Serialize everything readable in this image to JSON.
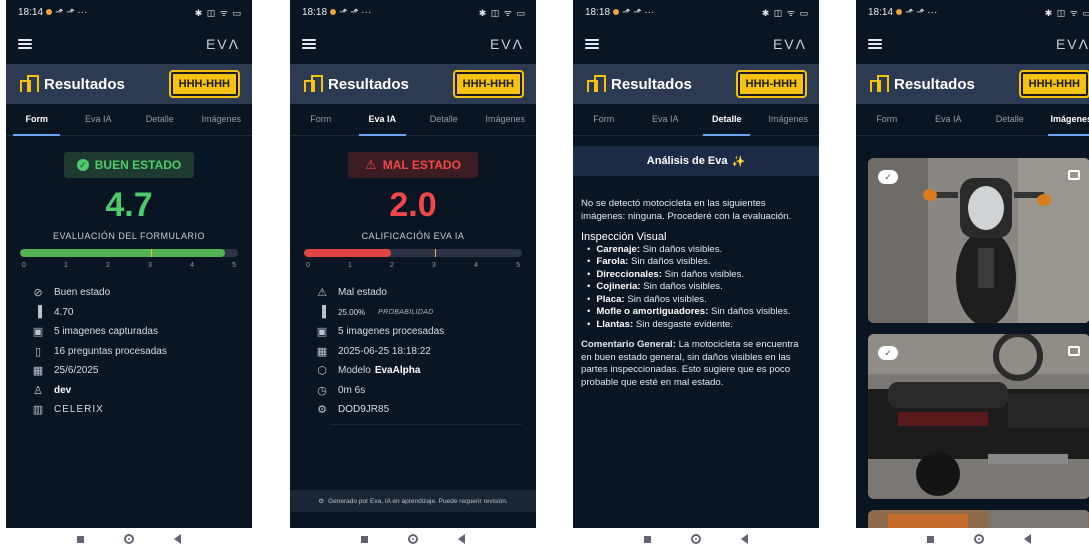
{
  "status": {
    "time_1": "18:14",
    "time_2": "18:18",
    "time_3": "18:18",
    "time_4": "18:14",
    "icons": "✱ ◫ ᯤ ▭"
  },
  "app": {
    "logo": "EVΛ",
    "title": "Resultados",
    "plate": "HHH-HHH"
  },
  "tabs": [
    "Form",
    "Eva IA",
    "Detalle",
    "Imágenes"
  ],
  "form": {
    "badge": "BUEN ESTADO",
    "score": "4.7",
    "score_label": "EVALUACIÓN DEL FORMULARIO",
    "progress_fraction": 0.94,
    "ticks": [
      "0",
      "1",
      "2",
      "3",
      "4",
      "5"
    ],
    "info": [
      {
        "icon": "check-circle-icon",
        "text": "Buen estado"
      },
      {
        "icon": "bar-chart-icon",
        "text": "4.70"
      },
      {
        "icon": "image-icon",
        "text": "5 imagenes capturadas"
      },
      {
        "icon": "clipboard-icon",
        "text": "16 preguntas procesadas"
      },
      {
        "icon": "calendar-icon",
        "text": "25/6/2025"
      },
      {
        "icon": "user-icon",
        "text": "dev"
      },
      {
        "icon": "building-icon",
        "text": "CELERIX"
      }
    ]
  },
  "eva": {
    "badge": "MAL ESTADO",
    "score": "2.0",
    "score_label": "CALIFICACIÓN EVA IA",
    "progress_fraction": 0.4,
    "ticks": [
      "0",
      "1",
      "2",
      "3",
      "4",
      "5"
    ],
    "info": {
      "status": "Mal estado",
      "probability_value": "25.00%",
      "probability_label": "PROBABILIDAD",
      "images": "5 imagenes procesadas",
      "datetime": "2025-06-25 18:18:22",
      "model_prefix": "Modelo",
      "model_name": "EvaAlpha",
      "duration": "0m 6s",
      "code": "DOD9JR85"
    },
    "footer": "Generado por Eva, IA en aprendizaje. Puede requerir revisión."
  },
  "detalle": {
    "heading": "Análisis de Eva",
    "intro": "No se detectó motocicleta en las siguientes imágenes: ninguna. Procederé con la evaluación.",
    "section_title": "Inspección Visual",
    "items": [
      {
        "label": "Carenaje:",
        "text": "Sin daños visibles."
      },
      {
        "label": "Farola:",
        "text": "Sin daños visibles."
      },
      {
        "label": "Direccionales:",
        "text": "Sin daños visibles."
      },
      {
        "label": "Cojinería:",
        "text": "Sin daños visibles."
      },
      {
        "label": "Placa:",
        "text": "Sin daños visibles."
      },
      {
        "label": "Mofle o amortiguadores:",
        "text": "Sin daños visibles."
      },
      {
        "label": "Llantas:",
        "text": "Sin desgaste evidente."
      }
    ],
    "summary_label": "Comentario General:",
    "summary_text": "La motocicleta se encuentra en buen estado general, sin daños visibles en las partes inspeccionadas. Esto sugiere que es poco probable que esté en mal estado."
  },
  "colors": {
    "background": "#0a1524",
    "header": "#2c3a52",
    "accent": "#6aa3f0",
    "good": "#4ccc6c",
    "bad": "#f04848",
    "plate": "#f5c211"
  }
}
